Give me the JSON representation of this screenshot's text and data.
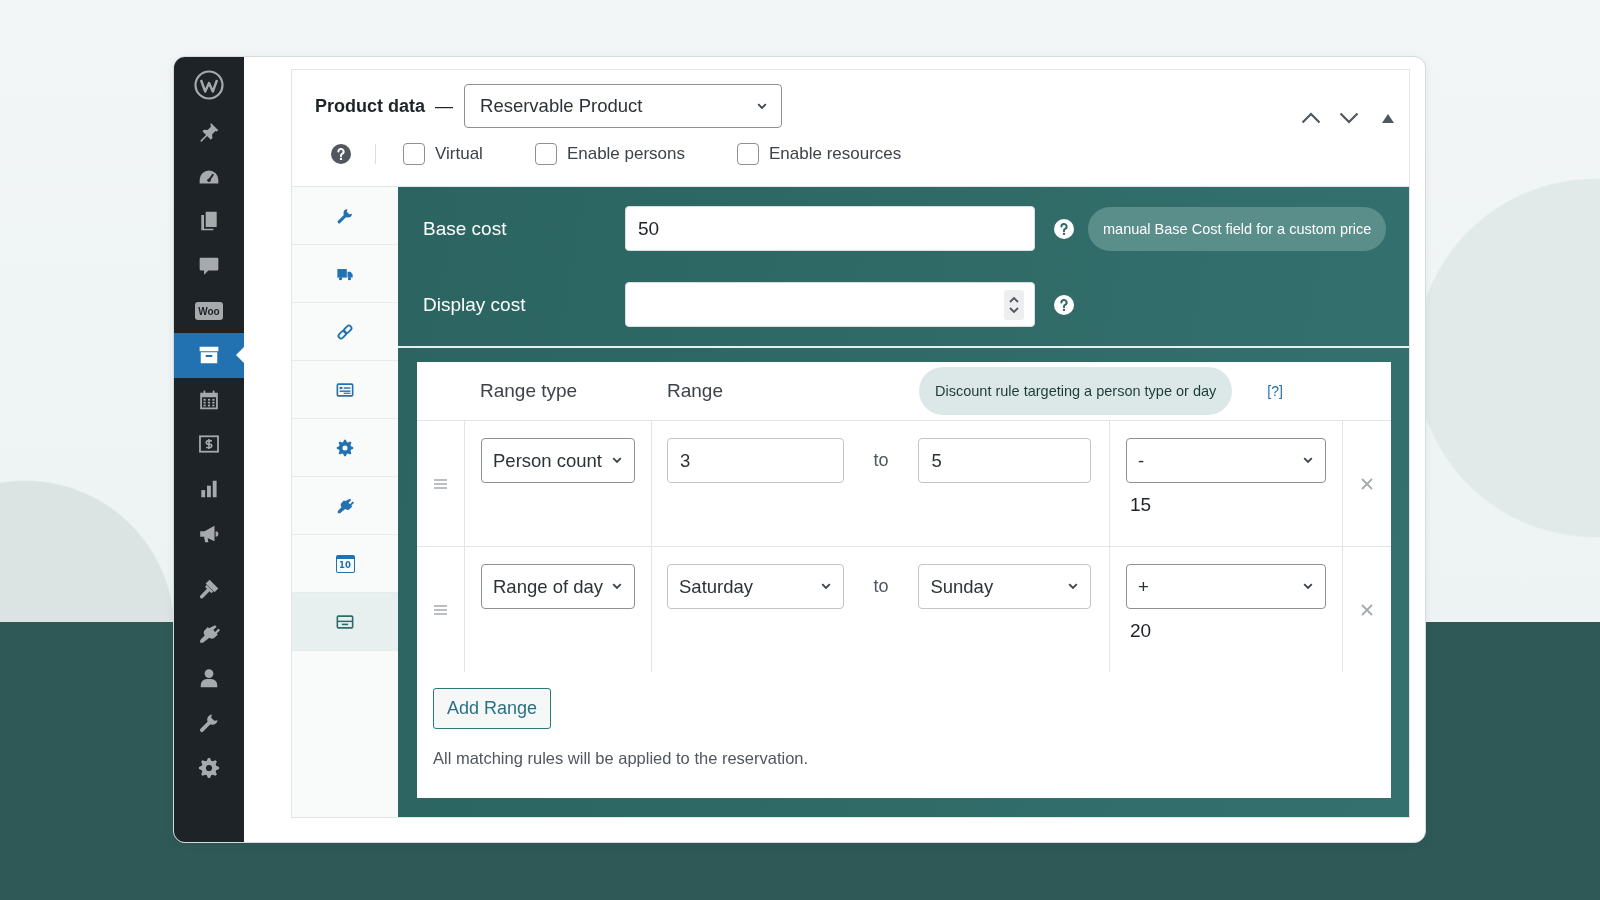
{
  "sidebar": {
    "groups": [
      {
        "items": [
          {
            "selected": false
          },
          {
            "selected": false
          },
          {
            "selected": false
          },
          {
            "selected": false
          },
          {
            "text": "Woo",
            "selected": false
          },
          {
            "selected": true
          },
          {
            "selected": false
          },
          {
            "selected": false
          },
          {
            "selected": false
          },
          {
            "selected": false
          }
        ]
      },
      {
        "items": [
          {
            "selected": false
          },
          {
            "selected": false
          },
          {
            "selected": false
          },
          {
            "selected": false
          },
          {
            "selected": false
          }
        ]
      }
    ]
  },
  "product_data": {
    "title": "Product data",
    "dash": "—",
    "product_type": "Reservable Product",
    "options": [
      {
        "label": "Virtual",
        "checked": false
      },
      {
        "label": "Enable persons",
        "checked": false
      },
      {
        "label": "Enable resources",
        "checked": false
      }
    ],
    "tabs": [
      {
        "selected": false
      },
      {
        "selected": false
      },
      {
        "selected": false
      },
      {
        "selected": false
      },
      {
        "selected": false
      },
      {
        "selected": false
      },
      {
        "text": "10",
        "selected": false
      },
      {
        "selected": true
      }
    ]
  },
  "pricing": {
    "cost_fields": [
      {
        "kind": "text",
        "label": "Base cost",
        "value": "50",
        "tooltip": "manual Base Cost field for a custom price"
      },
      {
        "kind": "number",
        "label": "Display cost"
      }
    ],
    "range_table": {
      "columns": [
        "Range type",
        "Range"
      ],
      "tooltip": "Discount rule targeting a person type or day",
      "help_link": "[?]",
      "rows": [
        {
          "range_type": "Person count",
          "kind": "number",
          "from": "3",
          "joiner": "to",
          "to": "5",
          "modifier": "-",
          "cost": "15"
        },
        {
          "range_type": "Range of day",
          "kind": "select",
          "from": "Saturday",
          "joiner": "to",
          "to": "Sunday",
          "modifier": "+",
          "cost": "20"
        }
      ]
    },
    "add_button": "Add Range",
    "note": "All matching rules will be applied to the reservation."
  }
}
